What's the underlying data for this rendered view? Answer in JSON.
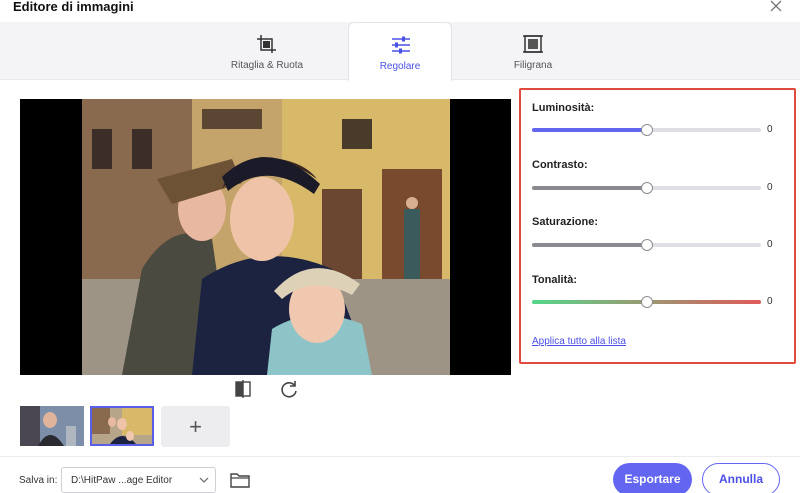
{
  "window": {
    "title": "Editore di immagini"
  },
  "tabs": [
    {
      "label": "Ritaglia & Ruota",
      "icon": "crop-icon"
    },
    {
      "label": "Regolare",
      "icon": "sliders-icon",
      "active": true
    },
    {
      "label": "Filigrana",
      "icon": "watermark-icon"
    }
  ],
  "adjustments": [
    {
      "label": "Luminosità:",
      "value": "0",
      "level": 0.5,
      "fill_color": "#6366f1"
    },
    {
      "label": "Contrasto:",
      "value": "0",
      "level": 0.5,
      "fill_color": "#8a8a90"
    },
    {
      "label": "Saturazione:",
      "value": "0",
      "level": 0.5,
      "fill_color": "#8a8a90"
    },
    {
      "label": "Tonalità:",
      "value": "0",
      "level": 0.5,
      "gradient": [
        "#55d68a",
        "#e05a5a"
      ]
    }
  ],
  "apply_all_label": "Applica tutto alla lista",
  "footer": {
    "save_label": "Salva in:",
    "save_path": "D:\\HitPaw ...age Editor",
    "export_label": "Esportare",
    "cancel_label": "Annulla"
  },
  "colors": {
    "accent": "#6366f1",
    "highlight_border": "#e04b3d"
  }
}
